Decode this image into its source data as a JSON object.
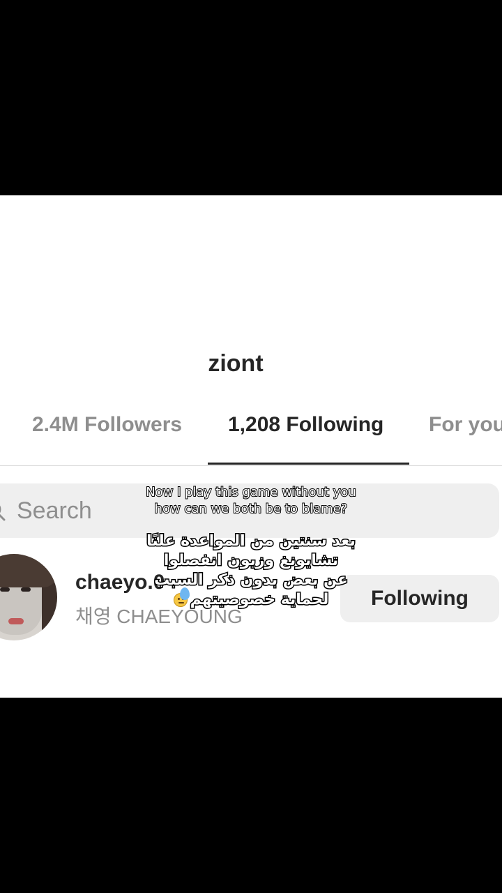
{
  "profile": {
    "username": "ziont"
  },
  "tabs": [
    {
      "label": "2.4M Followers"
    },
    {
      "label": "1,208 Following"
    },
    {
      "label": "For you"
    }
  ],
  "search": {
    "placeholder": "Search"
  },
  "following_list": [
    {
      "handle": "chaeyo.0",
      "full_name": "채영 CHAEYOUNG",
      "button_label": "Following"
    }
  ],
  "captions": {
    "english": [
      "Now I play this game without you",
      "how can we both be to blame?"
    ],
    "arabic": [
      "بعد سنتين من المواعدة علنًا",
      "تشايونغ وزيون انفصلوا",
      "عن بعض بدون ذكر السبب",
      "لحماية خصوصيتهم"
    ]
  },
  "icons": {
    "search": "search-icon",
    "caption_emoji": "slightly-frowning-face-icon"
  },
  "colors": {
    "background": "#ffffff",
    "letterbox": "#000000",
    "text_primary": "#262626",
    "text_secondary": "#8e8e8e",
    "button_bg": "#efefef"
  }
}
